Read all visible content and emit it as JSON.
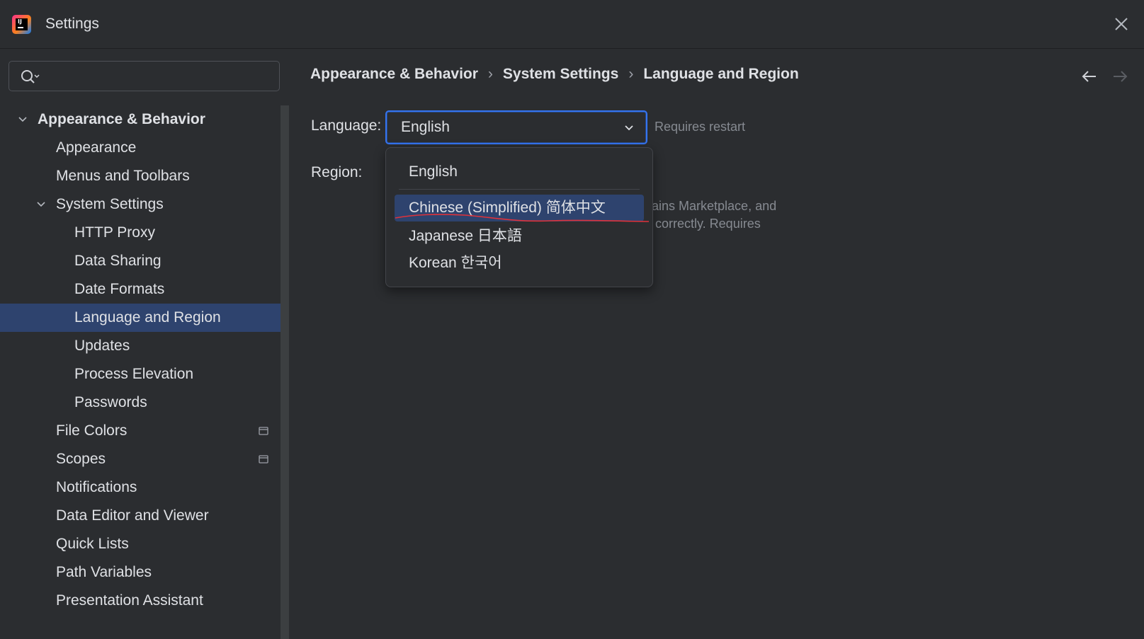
{
  "window": {
    "title": "Settings"
  },
  "search": {
    "placeholder": ""
  },
  "sidebar": {
    "items": [
      {
        "label": "Appearance & Behavior",
        "level": 0,
        "expanded": true,
        "bold": true
      },
      {
        "label": "Appearance",
        "level": 1
      },
      {
        "label": "Menus and Toolbars",
        "level": 1
      },
      {
        "label": "System Settings",
        "level": 1,
        "expanded": true
      },
      {
        "label": "HTTP Proxy",
        "level": 2
      },
      {
        "label": "Data Sharing",
        "level": 2
      },
      {
        "label": "Date Formats",
        "level": 2
      },
      {
        "label": "Language and Region",
        "level": 2,
        "selected": true
      },
      {
        "label": "Updates",
        "level": 2
      },
      {
        "label": "Process Elevation",
        "level": 2
      },
      {
        "label": "Passwords",
        "level": 2
      },
      {
        "label": "File Colors",
        "level": 1,
        "pinned": true
      },
      {
        "label": "Scopes",
        "level": 1,
        "pinned": true
      },
      {
        "label": "Notifications",
        "level": 1
      },
      {
        "label": "Data Editor and Viewer",
        "level": 1
      },
      {
        "label": "Quick Lists",
        "level": 1
      },
      {
        "label": "Path Variables",
        "level": 1
      },
      {
        "label": "Presentation Assistant",
        "level": 1
      }
    ]
  },
  "breadcrumb": [
    "Appearance & Behavior",
    "System Settings",
    "Language and Region"
  ],
  "form": {
    "language_label": "Language:",
    "language_value": "English",
    "language_hint": "Requires restart",
    "region_label": "Region:",
    "region_desc_1": "ains Marketplace, and",
    "region_desc_2": "correctly. Requires"
  },
  "dropdown": {
    "options": [
      {
        "label": "English"
      },
      {
        "label": "Chinese (Simplified) 简体中文",
        "highlighted": true
      },
      {
        "label": "Japanese 日本語"
      },
      {
        "label": "Korean 한국어"
      }
    ]
  },
  "colors": {
    "accent": "#3574f0",
    "selection": "#2e436e",
    "background": "#2b2d30",
    "annotation": "#e0323a"
  },
  "icons": [
    "app-logo-icon",
    "close-icon",
    "search-icon",
    "chevron-down-icon",
    "arrow-left-icon",
    "arrow-right-icon",
    "pin-icon"
  ]
}
